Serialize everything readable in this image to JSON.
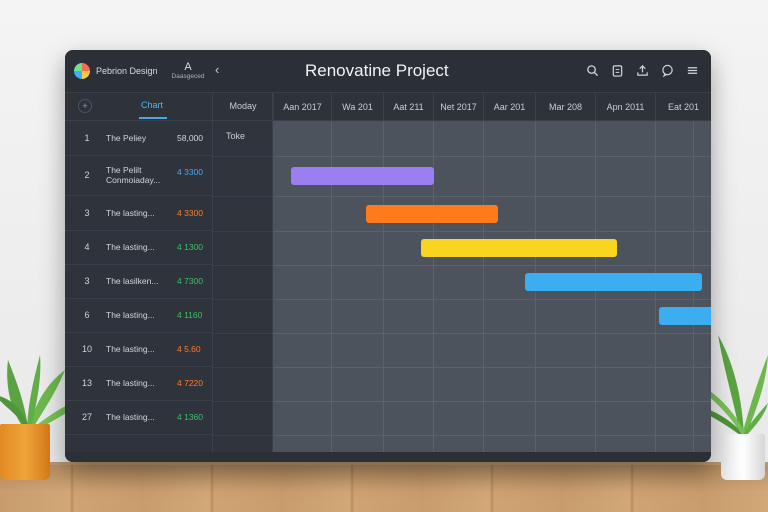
{
  "window": {
    "logo_text": "Pebrion Design",
    "user_label": "Daasgeced",
    "title": "Renovatine Project"
  },
  "header": {
    "chart_tab": "Chart",
    "day_col": "Moday",
    "timeline": [
      "Aan 2017",
      "Wa 201",
      "Aat 211",
      "Net 2017",
      "Aar 201",
      "Mar 208",
      "Apn 2011",
      "Eat 201"
    ]
  },
  "side_text": "Toke",
  "tasks": [
    {
      "num": "1",
      "name": "The Peliey",
      "value": "58,000",
      "dot_color": ""
    },
    {
      "num": "2",
      "name": "The Pelilt",
      "name2": "Conmoiaday...",
      "value": "4 3300",
      "dot_color": "#4aa6ea"
    },
    {
      "num": "3",
      "name": "The lasting...",
      "value": "4 3300",
      "dot_color": "#ff7b2e"
    },
    {
      "num": "4",
      "name": "The lasting...",
      "value": "4 1300",
      "dot_color": "#3fbf6a"
    },
    {
      "num": "3",
      "name": "The lasilken...",
      "value": "4 7300",
      "dot_color": "#3fbf6a"
    },
    {
      "num": "6",
      "name": "The lasting...",
      "value": "4 1160",
      "dot_color": "#3fbf6a"
    },
    {
      "num": "10",
      "name": "The lasting...",
      "value": "4 5.60",
      "dot_color": "#ff7b2e"
    },
    {
      "num": "13",
      "name": "The lasting...",
      "value": "4 7220",
      "dot_color": "#ff7b2e"
    },
    {
      "num": "27",
      "name": "The lasting...",
      "value": "4 1360",
      "dot_color": "#3fbf6a"
    }
  ],
  "bars": [
    {
      "row": 1,
      "color": "#9b7ef0"
    },
    {
      "row": 2,
      "color": "#ff7a1a"
    },
    {
      "row": 3,
      "color": "#f9d420"
    },
    {
      "row": 4,
      "color": "#3aaef0"
    },
    {
      "row": 5,
      "color": "#3aaef0"
    }
  ],
  "icons": [
    "search-icon",
    "clipboard-icon",
    "share-icon",
    "chat-icon",
    "menu-icon"
  ]
}
